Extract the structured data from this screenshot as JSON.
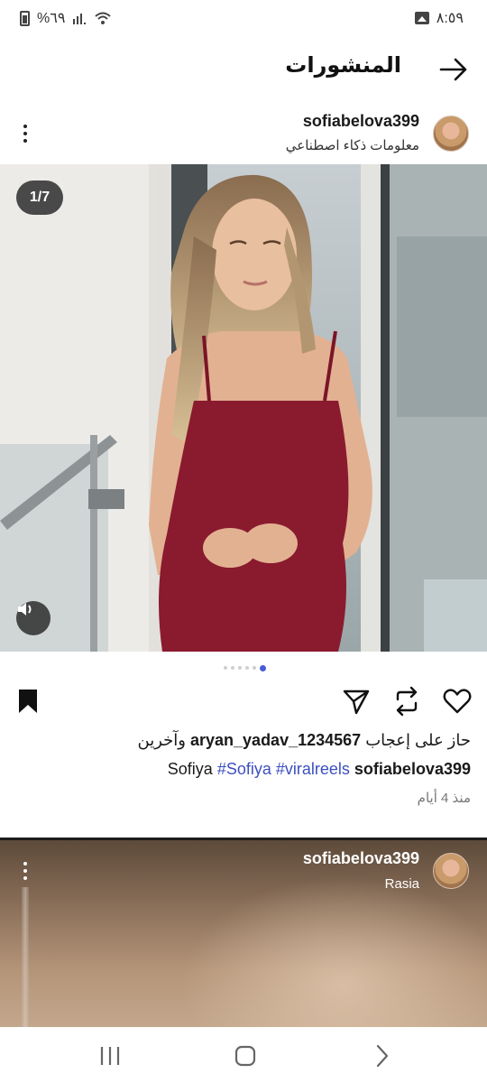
{
  "status_bar": {
    "battery": "%٦٩",
    "time": "٨:٥٩",
    "icons": [
      "battery-icon",
      "signal-icon",
      "wifi-icon",
      "gallery-icon"
    ]
  },
  "header": {
    "title": "المنشورات",
    "back_icon": "arrow-right-icon"
  },
  "post": {
    "username": "sofiabelova399",
    "subtitle": "معلومات ذكاء اصطناعي",
    "image_counter": "1/7",
    "pager": {
      "total": 6,
      "active_index": 5
    },
    "likes": {
      "prefix": "حاز على إعجاب",
      "user": "aryan_yadav_1234567",
      "suffix": "وآخرين"
    },
    "caption": {
      "username": "sofiabelova399",
      "hashtags": [
        "#viralreels",
        "#Sofiya"
      ],
      "text": "Sofiya"
    },
    "time_ago": "منذ 4 أيام"
  },
  "post2": {
    "username": "sofiabelova399",
    "subtitle": "Rasia"
  },
  "nav_bar": {
    "icons": [
      "recent-apps-icon",
      "home-icon",
      "back-chevron-icon"
    ]
  },
  "colors": {
    "accent": "#3d4fbf",
    "pager_active": "#4a5bd4",
    "dress": "#8a1a2e"
  }
}
